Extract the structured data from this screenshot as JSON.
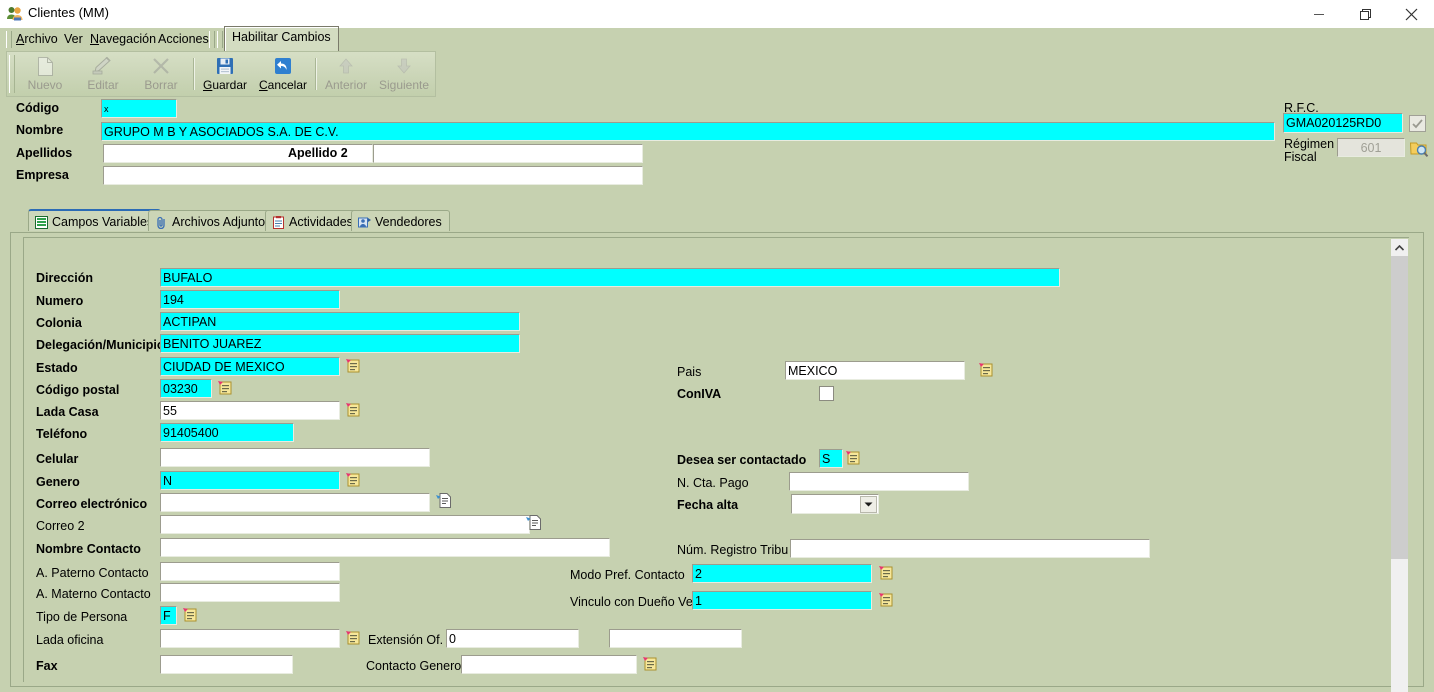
{
  "window": {
    "title": "Clientes (MM)",
    "icon": "clients-icon",
    "minimize": "minimize-icon",
    "maximize": "restore-icon",
    "close": "close-icon"
  },
  "menu": {
    "items": [
      {
        "label": "Archivo",
        "accel": "A"
      },
      {
        "label": "Ver",
        "accel": ""
      },
      {
        "label": "Navegación",
        "accel": "N"
      },
      {
        "label": "Acciones",
        "accel": ""
      }
    ],
    "habilitar_cambios": "Habilitar Cambios"
  },
  "toolbar": {
    "buttons": [
      {
        "label": "Nuevo",
        "icon": "new-page-icon",
        "enabled": false
      },
      {
        "label": "Editar",
        "icon": "edit-pencil-icon",
        "enabled": false
      },
      {
        "label": "Borrar",
        "icon": "delete-x-icon",
        "enabled": false
      },
      {
        "label": "Guardar",
        "icon": "save-floppy-icon",
        "enabled": true
      },
      {
        "label": "Cancelar",
        "icon": "undo-arrow-icon",
        "enabled": true
      },
      {
        "label": "Anterior",
        "icon": "arrow-up-icon",
        "enabled": false
      },
      {
        "label": "Siguiente",
        "icon": "arrow-down-icon",
        "enabled": false
      }
    ]
  },
  "header": {
    "codigo_label": "Código",
    "codigo_value": "x",
    "nombre_label": "Nombre",
    "nombre_value": "GRUPO M B  Y ASOCIADOS S.A. DE C.V.",
    "apellidos_label": "Apellidos",
    "apellido1_value": "",
    "apellido2_label": "Apellido 2",
    "apellido2_value": "",
    "empresa_label": "Empresa",
    "empresa_value": "",
    "rfc_label": "R.F.C.",
    "rfc_value": "GMA020125RD0",
    "rfc_checkbox_checked": true,
    "regimen_label_line1": "Régimen",
    "regimen_label_line2": "Fiscal",
    "regimen_value": "601",
    "regimen_search_icon": "folder-search-icon"
  },
  "tabs": [
    {
      "label": "Campos Variables",
      "icon": "grid-table-icon",
      "active": true
    },
    {
      "label": "Archivos Adjuntos",
      "icon": "paperclip-icon",
      "active": false
    },
    {
      "label": "Actividades",
      "icon": "clipboard-icon",
      "active": false
    },
    {
      "label": "Vendedores",
      "icon": "sales-person-icon",
      "active": false
    }
  ],
  "form": {
    "left": [
      {
        "label": "Dirección",
        "bold": true,
        "value": "BUFALO",
        "cyan": true,
        "lookup": false
      },
      {
        "label": "Numero",
        "bold": true,
        "value": "194",
        "cyan": true,
        "lookup": false
      },
      {
        "label": "Colonia",
        "bold": true,
        "value": "ACTIPAN",
        "cyan": true,
        "lookup": false
      },
      {
        "label": "Delegación/Municipio",
        "bold": true,
        "value": "BENITO JUAREZ",
        "cyan": true,
        "lookup": false
      },
      {
        "label": "Estado",
        "bold": true,
        "value": "CIUDAD DE MEXICO",
        "cyan": true,
        "lookup": true
      },
      {
        "label": "Código postal",
        "bold": true,
        "value": "03230",
        "cyan": true,
        "lookup": true
      },
      {
        "label": "Lada Casa",
        "bold": true,
        "value": "55",
        "cyan": false,
        "lookup": true
      },
      {
        "label": "Teléfono",
        "bold": true,
        "value": "91405400",
        "cyan": true,
        "lookup": false
      },
      {
        "label": "Celular",
        "bold": true,
        "value": "",
        "cyan": false,
        "lookup": false
      },
      {
        "label": "Genero",
        "bold": true,
        "value": "N",
        "cyan": true,
        "lookup": true
      },
      {
        "label": "Correo electrónico",
        "bold": true,
        "value": "",
        "cyan": false,
        "lookup": false,
        "mail": true
      },
      {
        "label": "Correo 2",
        "bold": false,
        "value": "",
        "cyan": false,
        "lookup": false,
        "mail": true
      },
      {
        "label": "Nombre Contacto",
        "bold": true,
        "value": "",
        "cyan": false,
        "lookup": false
      },
      {
        "label": "A. Paterno Contacto",
        "bold": false,
        "value": "",
        "cyan": false,
        "lookup": false
      },
      {
        "label": "A. Materno Contacto",
        "bold": false,
        "value": "",
        "cyan": false,
        "lookup": false
      },
      {
        "label": "Tipo de Persona",
        "bold": false,
        "value": "F",
        "cyan": true,
        "lookup": true
      },
      {
        "label": "Lada oficina",
        "bold": false,
        "value": "",
        "cyan": false,
        "lookup": true
      },
      {
        "label": "Fax",
        "bold": true,
        "value": "",
        "cyan": false,
        "lookup": false
      }
    ],
    "right": [
      {
        "label": "Pais",
        "bold": false,
        "value": "MEXICO",
        "cyan": false,
        "lookup": true
      },
      {
        "label": "ConIVA",
        "bold": true,
        "checkbox": true,
        "checked": false
      },
      {
        "label": "Desea ser contactado",
        "bold": true,
        "value": "S",
        "cyan": true,
        "lookup": true
      },
      {
        "label": "N. Cta. Pago",
        "bold": false,
        "value": "",
        "cyan": false,
        "lookup": false
      },
      {
        "label": "Fecha alta",
        "bold": true,
        "value": "",
        "combo": true
      },
      {
        "label": "Núm. Registro Tribu",
        "bold": false,
        "value": "",
        "cyan": false,
        "lookup": false
      },
      {
        "label": "Modo Pref. Contacto",
        "bold": false,
        "value": "2",
        "cyan": true,
        "lookup": true
      },
      {
        "label": "Vinculo con Dueño Ve",
        "bold": false,
        "value": "1",
        "cyan": true,
        "lookup": true
      },
      {
        "label": "Extensión Of.",
        "bold": false,
        "value": "0",
        "cyan": false,
        "lookup": false
      },
      {
        "label": "Contacto Genero",
        "bold": false,
        "value": "",
        "cyan": false,
        "lookup": true
      }
    ]
  },
  "colors": {
    "background": "#c6d1b0",
    "highlight": "#00ffff",
    "field_bg": "#ffffff",
    "disabled_bg": "#e4e4dc",
    "tab_active_border": "#2b6bb5"
  },
  "scrollbar": {
    "up_icon": "chevron-up-icon"
  }
}
